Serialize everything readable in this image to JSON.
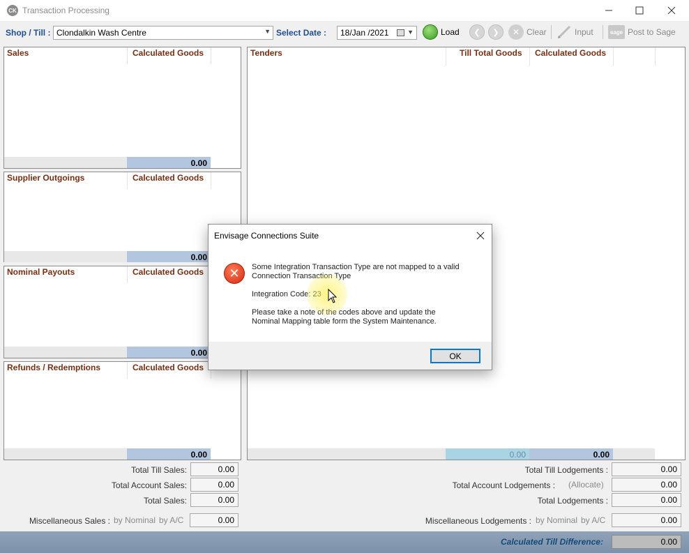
{
  "window": {
    "title": "Transaction Processing",
    "icon": "ck-app-icon"
  },
  "toolbar": {
    "shop_label": "Shop / Till :",
    "shop_value": "Clondalkin Wash Centre",
    "date_label": "Select Date :",
    "date_value": "18/Jan /2021",
    "load_label": "Load",
    "clear_label": "Clear",
    "input_label": "Input",
    "post_label": "Post to Sage",
    "sage_icon_text": "sage"
  },
  "panels": {
    "sales": {
      "title": "Sales",
      "col": "Calculated Goods",
      "total": "0.00"
    },
    "supplier": {
      "title": "Supplier Outgoings",
      "col": "Calculated Goods",
      "total": "0.00"
    },
    "nominal": {
      "title": "Nominal Payouts",
      "col": "Calculated Goods",
      "total": "0.00"
    },
    "refunds": {
      "title": "Refunds / Redemptions",
      "col": "Calculated Goods",
      "total": "0.00"
    },
    "tenders": {
      "title": "Tenders",
      "col1": "Till Total Goods",
      "col2": "Calculated Goods",
      "total1": "0.00",
      "total2": "0.00"
    }
  },
  "summary_left": {
    "total_till_sales_label": "Total Till Sales:",
    "total_till_sales": "0.00",
    "total_account_sales_label": "Total Account Sales:",
    "total_account_sales": "0.00",
    "total_sales_label": "Total Sales:",
    "total_sales": "0.00",
    "misc_sales_label": "Miscellaneous Sales :",
    "by_nominal": "by Nominal",
    "by_ac": "by A/C",
    "misc_sales": "0.00"
  },
  "summary_right": {
    "total_till_lodgements_label": "Total Till Lodgements :",
    "total_till_lodgements": "0.00",
    "total_account_lodgements_label": "Total Account Lodgements :",
    "allocate": "(Allocate)",
    "total_account_lodgements": "0.00",
    "total_lodgements_label": "Total Lodgements :",
    "total_lodgements": "0.00",
    "misc_lodgements_label": "Miscellaneous Lodgements :",
    "by_nominal": "by Nominal",
    "by_ac": "by A/C",
    "misc_lodgements": "0.00"
  },
  "difference": {
    "label": "Calculated Till Difference:",
    "value": "0.00"
  },
  "dialog": {
    "title": "Envisage Connections Suite",
    "line1": "Some Integration Transaction Type are not mapped to a valid",
    "line2": "Connection Transaction Type",
    "code_line": "Integration Code: 23",
    "note1": "Please take a note of the codes above and update the",
    "note2": "Nominal Mapping table form the System Maintenance.",
    "ok_label": "OK"
  },
  "colors": {
    "header_text": "#7a2e12",
    "label_blue": "#1f4e99",
    "total_fill": "#b3c6e0",
    "dialog_focus": "#0078d7"
  }
}
